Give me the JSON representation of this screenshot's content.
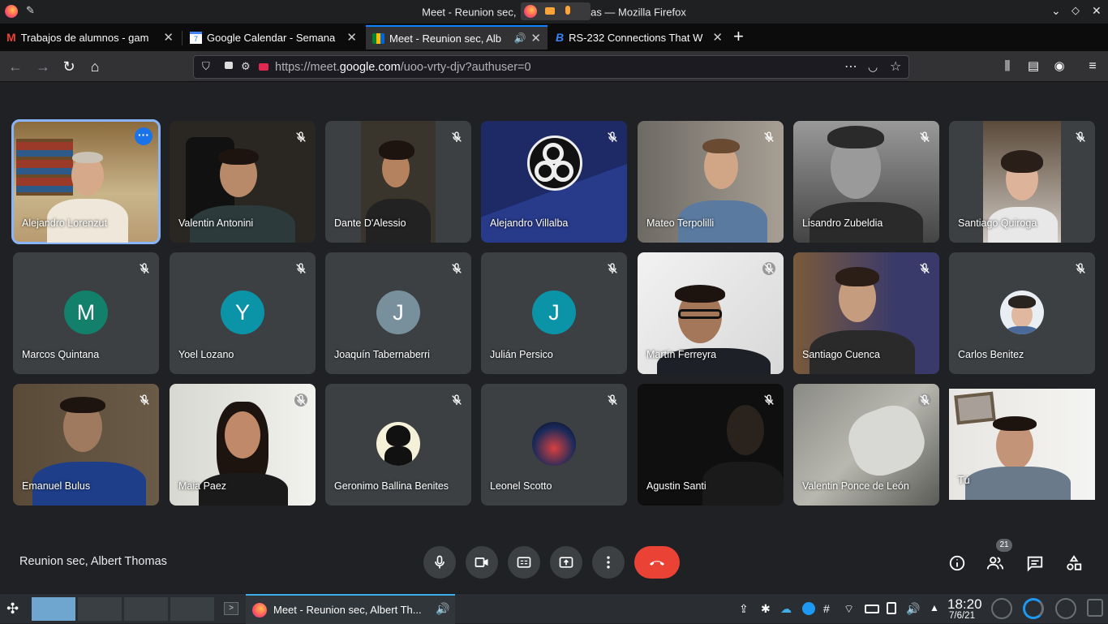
{
  "window": {
    "title": "Meet - Reunion sec, Albert Thomas — Mozilla Firefox",
    "title_shown": "Meet - Reunion sec, ",
    "title_tail": "as — Mozilla Firefox"
  },
  "tabs": [
    {
      "label": "Trabajos de alumnos - gam",
      "icon": "gmail-icon"
    },
    {
      "label": "Google Calendar - Semana",
      "icon": "calendar-icon"
    },
    {
      "label": "Meet - Reunion sec, Alb",
      "icon": "meet-icon",
      "active": true
    },
    {
      "label": "RS-232 Connections That W",
      "icon": "b-icon"
    }
  ],
  "urlbar": {
    "host_prefix": "https://meet.",
    "host": "google.com",
    "path": "/uoo-vrty-djv?authuser=0"
  },
  "participants": [
    {
      "name": "Alejandro Lorenzut",
      "type": "video",
      "pinned_menu": true
    },
    {
      "name": "Valentin Antonini",
      "type": "video"
    },
    {
      "name": "Dante D'Alessio",
      "type": "video"
    },
    {
      "name": "Alejandro Villalba",
      "type": "obs"
    },
    {
      "name": "Mateo Terpolilli",
      "type": "video"
    },
    {
      "name": "Lisandro Zubeldia",
      "type": "video"
    },
    {
      "name": "Santiago Quiroga",
      "type": "video"
    },
    {
      "name": "Marcos Quintana",
      "type": "avatar",
      "letter": "M",
      "color": "#12806b"
    },
    {
      "name": "Yoel Lozano",
      "type": "avatar",
      "letter": "Y",
      "color": "#0b94a8"
    },
    {
      "name": "Joaquín Tabernaberri",
      "type": "avatar",
      "letter": "J",
      "color": "#78909c"
    },
    {
      "name": "Julián Persico",
      "type": "avatar",
      "letter": "J",
      "color": "#0b94a8"
    },
    {
      "name": "Martín Ferreyra",
      "type": "video"
    },
    {
      "name": "Santiago Cuenca",
      "type": "video"
    },
    {
      "name": "Carlos Benitez",
      "type": "photo"
    },
    {
      "name": "Emanuel Bulus",
      "type": "video"
    },
    {
      "name": "Maia Paez",
      "type": "video"
    },
    {
      "name": "Geronimo Ballina Benites",
      "type": "photo"
    },
    {
      "name": "Leonel Scotto",
      "type": "photo"
    },
    {
      "name": "Agustin Santi",
      "type": "video"
    },
    {
      "name": "Valentin Ponce de León",
      "type": "video"
    },
    {
      "name": "Tú",
      "type": "video"
    }
  ],
  "meeting": {
    "name": "Reunion sec, Albert Thomas",
    "participant_count": "21"
  },
  "taskbar": {
    "task_label": "Meet - Reunion sec, Albert Th...",
    "time": "18:20",
    "date": "7/6/21"
  }
}
